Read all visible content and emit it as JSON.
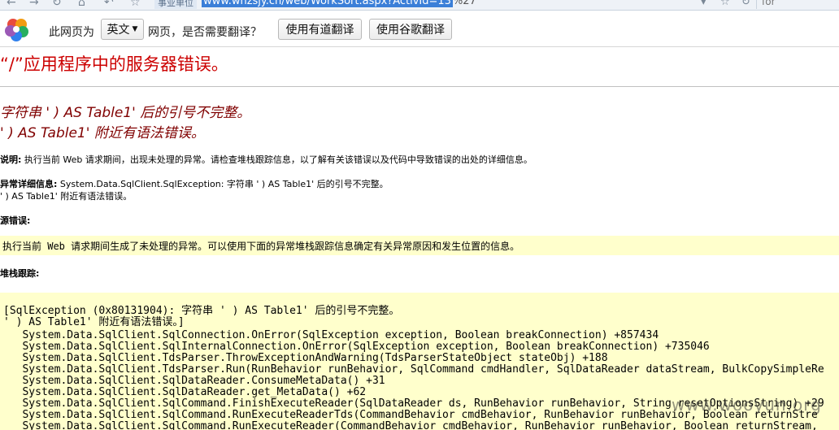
{
  "chrome": {
    "tag": "事业单位",
    "url_selected": "www.whzsjy.cn/web/WorkSort.aspx?ActivId=13",
    "url_rest": "%27",
    "search_text": "for"
  },
  "translate_bar": {
    "prefix": "此网页为",
    "language": "英文",
    "question": "网页，是否需要翻译？",
    "youdao_button": "使用有道翻译",
    "google_button": "使用谷歌翻译"
  },
  "error": {
    "title": "“/”应用程序中的服务器错误。",
    "message_line1": "字符串 ' ) AS Table1' 后的引号不完整。",
    "message_line2": "' ) AS Table1' 附近有语法错误。",
    "desc_label": "说明:",
    "desc_text": " 执行当前 Web 请求期间，出现未处理的异常。请检查堆栈跟踪信息，以了解有关该错误以及代码中导致错误的出处的详细信息。",
    "exception_label": "异常详细信息:",
    "exception_text": " System.Data.SqlClient.SqlException: 字符串 ' ) AS Table1' 后的引号不完整。",
    "exception_line2": "' ) AS Table1' 附近有语法错误。",
    "source_label": "源错误:",
    "source_text": "执行当前 Web 请求期间生成了未处理的异常。可以使用下面的异常堆栈跟踪信息确定有关异常原因和发生位置的信息。",
    "stack_label": "堆栈跟踪:",
    "stack_lines": [
      "[SqlException (0x80131904): 字符串 ' ) AS Table1' 后的引号不完整。",
      "' ) AS Table1' 附近有语法错误。]",
      "   System.Data.SqlClient.SqlConnection.OnError(SqlException exception, Boolean breakConnection) +857434",
      "   System.Data.SqlClient.SqlInternalConnection.OnError(SqlException exception, Boolean breakConnection) +735046",
      "   System.Data.SqlClient.TdsParser.ThrowExceptionAndWarning(TdsParserStateObject stateObj) +188",
      "   System.Data.SqlClient.TdsParser.Run(RunBehavior runBehavior, SqlCommand cmdHandler, SqlDataReader dataStream, BulkCopySimpleRe",
      "   System.Data.SqlClient.SqlDataReader.ConsumeMetaData() +31",
      "   System.Data.SqlClient.SqlDataReader.get_MetaData() +62",
      "   System.Data.SqlClient.SqlCommand.FinishExecuteReader(SqlDataReader ds, RunBehavior runBehavior, String resetOptionsString) +29",
      "   System.Data.SqlClient.SqlCommand.RunExecuteReaderTds(CommandBehavior cmdBehavior, RunBehavior runBehavior, Boolean returnStre",
      "   System.Data.SqlClient.SqlCommand.RunExecuteReader(CommandBehavior cmdBehavior, RunBehavior runBehavior, Boolean returnStream,"
    ]
  },
  "watermark": "www.wooyun.org"
}
